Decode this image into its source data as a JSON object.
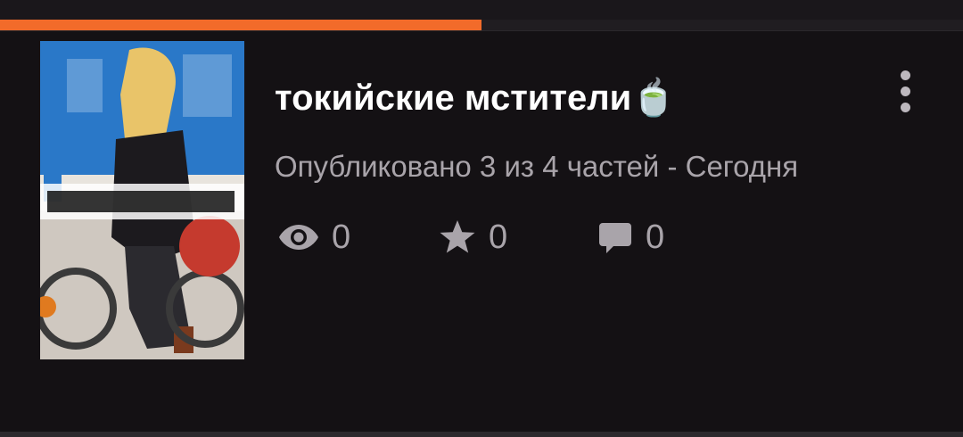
{
  "reading_progress": {
    "fraction": 0.5
  },
  "story": {
    "title": "токийские мстители🍵",
    "cover_icon": "manga-cover-image",
    "subtitle": "Опубликовано 3 из 4 частей - Сегодня",
    "stats": {
      "views": "0",
      "stars": "0",
      "comments": "0"
    }
  },
  "icons": {
    "views": "eye-icon",
    "stars": "star-icon",
    "comments": "comment-icon",
    "menu": "more-vertical-icon"
  },
  "colors": {
    "accent": "#f26b2a",
    "background": "#141114",
    "text_primary": "#ffffff",
    "text_secondary": "#a9a4aa"
  }
}
